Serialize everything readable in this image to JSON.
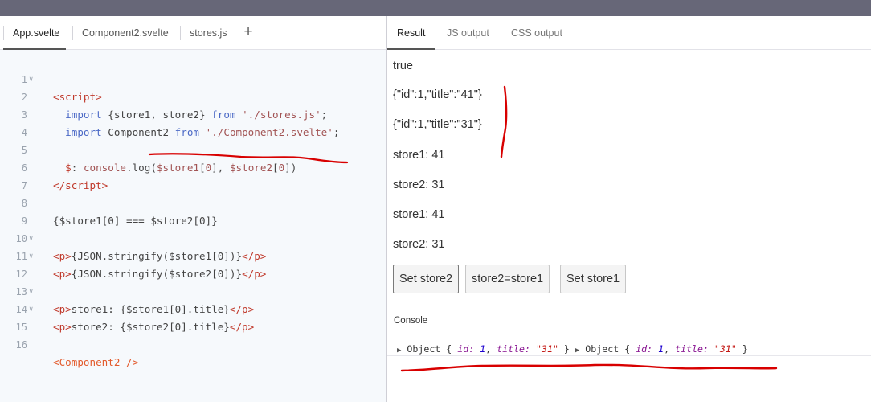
{
  "editor": {
    "tabs": [
      {
        "label": "App.svelte",
        "active": true
      },
      {
        "label": "Component2.svelte",
        "active": false
      },
      {
        "label": "stores.js",
        "active": false
      }
    ],
    "add_tab": "+",
    "lines": {
      "n1": "1",
      "n2": "2",
      "n3": "3",
      "n4": "4",
      "n5": "5",
      "n6": "6",
      "n7": "7",
      "n8": "8",
      "n9": "9",
      "n10": "10",
      "n11": "11",
      "n12": "12",
      "n13": "13",
      "n14": "14",
      "n15": "15",
      "n16": "16"
    }
  },
  "result_tabs": [
    {
      "label": "Result",
      "active": true
    },
    {
      "label": "JS output",
      "active": false
    },
    {
      "label": "CSS output",
      "active": false
    }
  ],
  "output": {
    "lines": [
      "true",
      "{\"id\":1,\"title\":\"41\"}",
      "{\"id\":1,\"title\":\"31\"}",
      "store1: 41",
      "store2: 31",
      "store1: 41",
      "store2: 31"
    ],
    "buttons": [
      "Set store2",
      "store2=store1",
      "Set store1"
    ]
  },
  "console": {
    "title": "Console",
    "entries": [
      "Object",
      "id:",
      "1",
      "title:",
      "\"31\""
    ]
  },
  "colors": {
    "annotation": "#d80000",
    "topbar": "#676778"
  }
}
